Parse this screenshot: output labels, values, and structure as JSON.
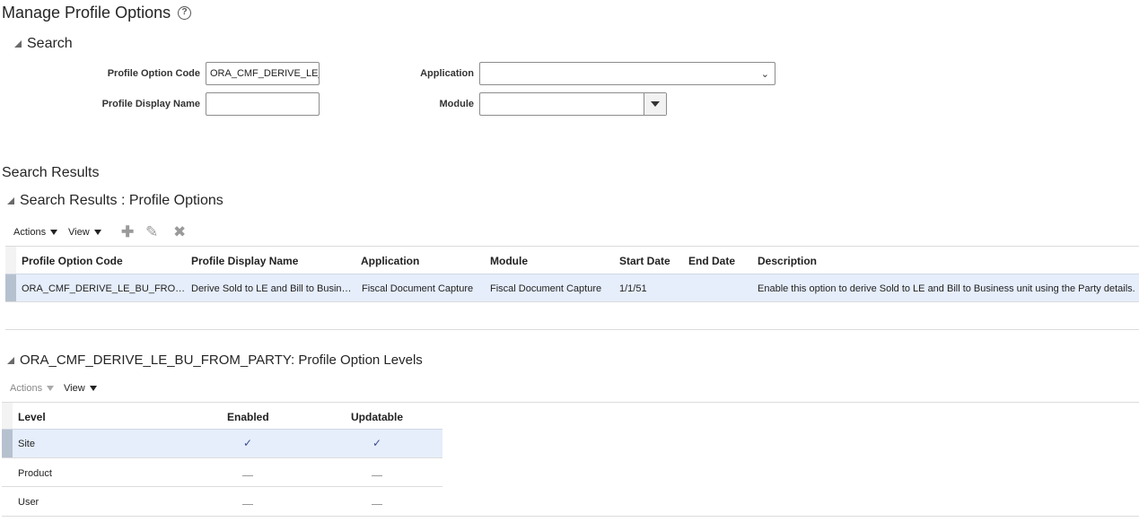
{
  "page": {
    "title": "Manage Profile Options",
    "help_icon": "?"
  },
  "search": {
    "header": "Search",
    "fields": {
      "profile_option_code": {
        "label": "Profile Option Code",
        "value": "ORA_CMF_DERIVE_LE_"
      },
      "profile_display_name": {
        "label": "Profile Display Name",
        "value": ""
      },
      "application": {
        "label": "Application",
        "value": ""
      },
      "module": {
        "label": "Module",
        "value": ""
      }
    }
  },
  "results": {
    "title": "Search Results",
    "section_header": "Search Results : Profile Options",
    "toolbar": {
      "actions": "Actions",
      "view": "View"
    },
    "columns": [
      "Profile Option Code",
      "Profile Display Name",
      "Application",
      "Module",
      "Start Date",
      "End Date",
      "Description"
    ],
    "rows": [
      {
        "code": "ORA_CMF_DERIVE_LE_BU_FRO…",
        "display_name": "Derive Sold to LE and Bill to Busin…",
        "application": "Fiscal Document Capture",
        "module": "Fiscal Document Capture",
        "start_date": "1/1/51",
        "end_date": "",
        "description": "Enable this option to derive Sold to LE and Bill to Business unit using the Party details."
      }
    ]
  },
  "levels": {
    "section_header": "ORA_CMF_DERIVE_LE_BU_FROM_PARTY: Profile Option Levels",
    "toolbar": {
      "actions": "Actions",
      "view": "View"
    },
    "columns": [
      "Level",
      "Enabled",
      "Updatable"
    ],
    "rows": [
      {
        "level": "Site",
        "enabled": true,
        "updatable": true
      },
      {
        "level": "Product",
        "enabled": false,
        "updatable": false
      },
      {
        "level": "User",
        "enabled": false,
        "updatable": false
      }
    ],
    "check_mark": "✓"
  },
  "colors": {
    "selected_row": "#e6eefb",
    "check": "#3a4d8c"
  }
}
